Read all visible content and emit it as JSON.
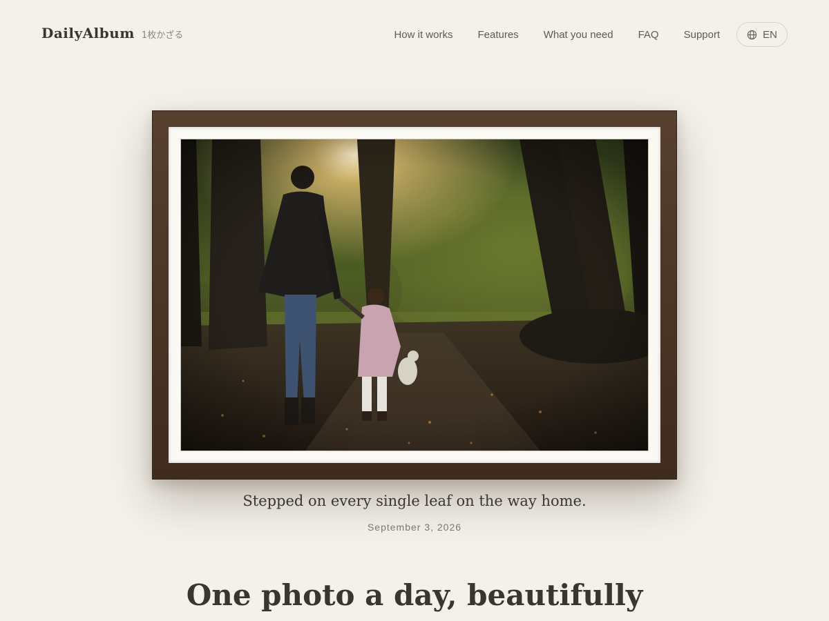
{
  "brand": {
    "name": "DailyAlbum",
    "tagline": "1枚かざる"
  },
  "nav": {
    "items": [
      {
        "label": "How it works"
      },
      {
        "label": "Features"
      },
      {
        "label": "What you need"
      },
      {
        "label": "FAQ"
      },
      {
        "label": "Support"
      }
    ],
    "language": {
      "label": "EN",
      "icon": "globe-icon"
    }
  },
  "featured": {
    "caption": "Stepped on every single leaf on the way home.",
    "date": "September 3, 2026",
    "photo_subject": "adult and child walking hand in hand on a forest path at sunset",
    "frame_color": "#4a3526",
    "mat_color": "#fbf9f4"
  },
  "hero": {
    "headline": "One photo a day, beautifully"
  },
  "colors": {
    "background": "#f4f1eb",
    "text": "#3a352f",
    "muted": "#7d776e"
  }
}
